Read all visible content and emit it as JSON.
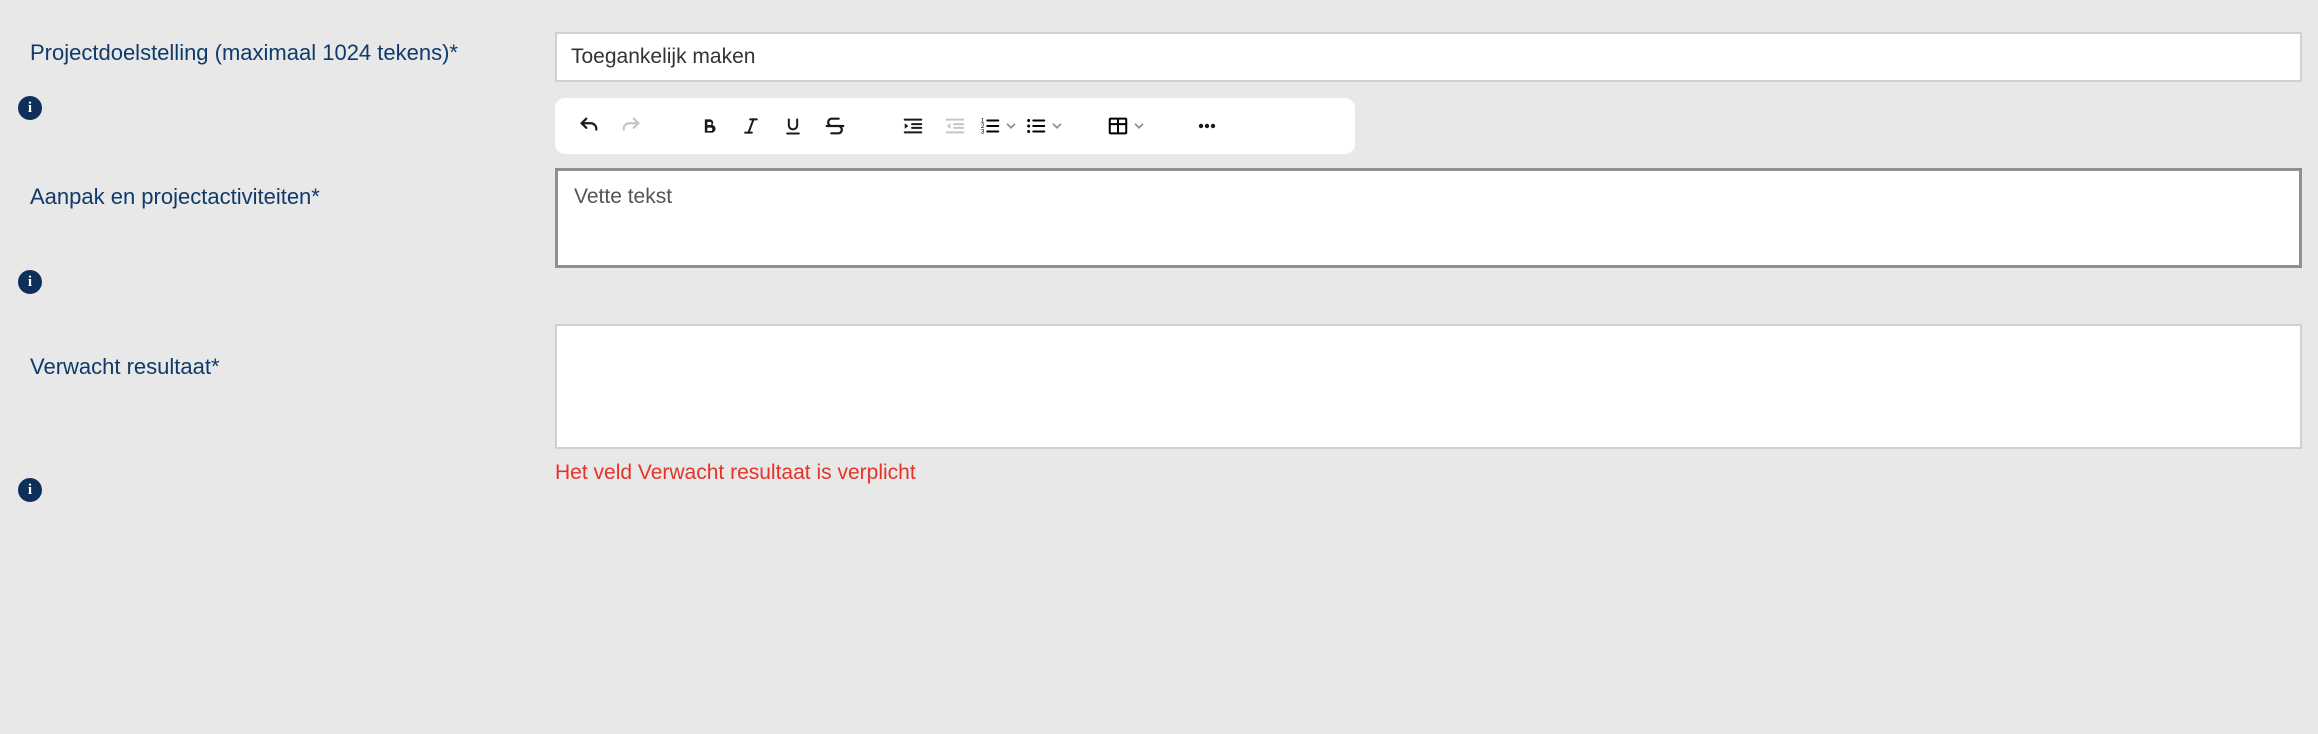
{
  "fields": {
    "projectdoelstelling": {
      "label": "Projectdoelstelling (maximaal 1024 tekens)*",
      "value": "Toegankelijk maken"
    },
    "aanpak": {
      "label": "Aanpak en projectactiviteiten*",
      "value": "Vette tekst"
    },
    "verwacht": {
      "label": "Verwacht resultaat*",
      "value": "",
      "error": "Het veld Verwacht resultaat is verplicht"
    }
  },
  "toolbar": {
    "undo": "undo",
    "redo": "redo",
    "bold": "bold",
    "italic": "italic",
    "underline": "underline",
    "strike": "strikethrough",
    "indent": "indent",
    "outdent": "outdent",
    "numlist": "numbered-list",
    "bulletlist": "bullet-list",
    "table": "table",
    "more": "more"
  }
}
